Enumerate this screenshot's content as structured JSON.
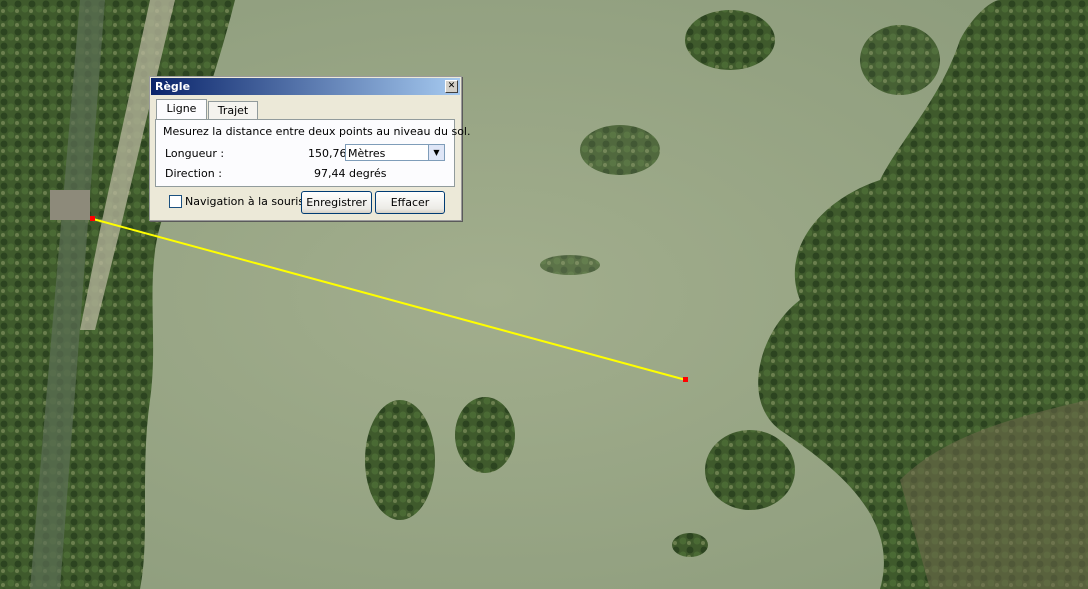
{
  "dialog": {
    "title": "Règle",
    "tabs": [
      {
        "label": "Ligne",
        "active": true
      },
      {
        "label": "Trajet",
        "active": false
      }
    ],
    "description": "Mesurez la distance entre deux points au niveau du sol.",
    "length_label": "Longueur :",
    "length_value": "150,76",
    "unit_selected": "Mètres",
    "direction_label": "Direction :",
    "direction_value": "97,44 degrés",
    "mouse_nav_label": "Navigation à la souris",
    "mouse_nav_checked": false,
    "save_label": "Enregistrer",
    "clear_label": "Effacer"
  },
  "measure_line": {
    "color": "#ffff00",
    "endpoint_color": "#ff0000"
  },
  "colors": {
    "water": "#9aa888",
    "vegetation": "#3d5a2a",
    "titlebar_start": "#0a246a",
    "titlebar_end": "#a6caf0"
  }
}
